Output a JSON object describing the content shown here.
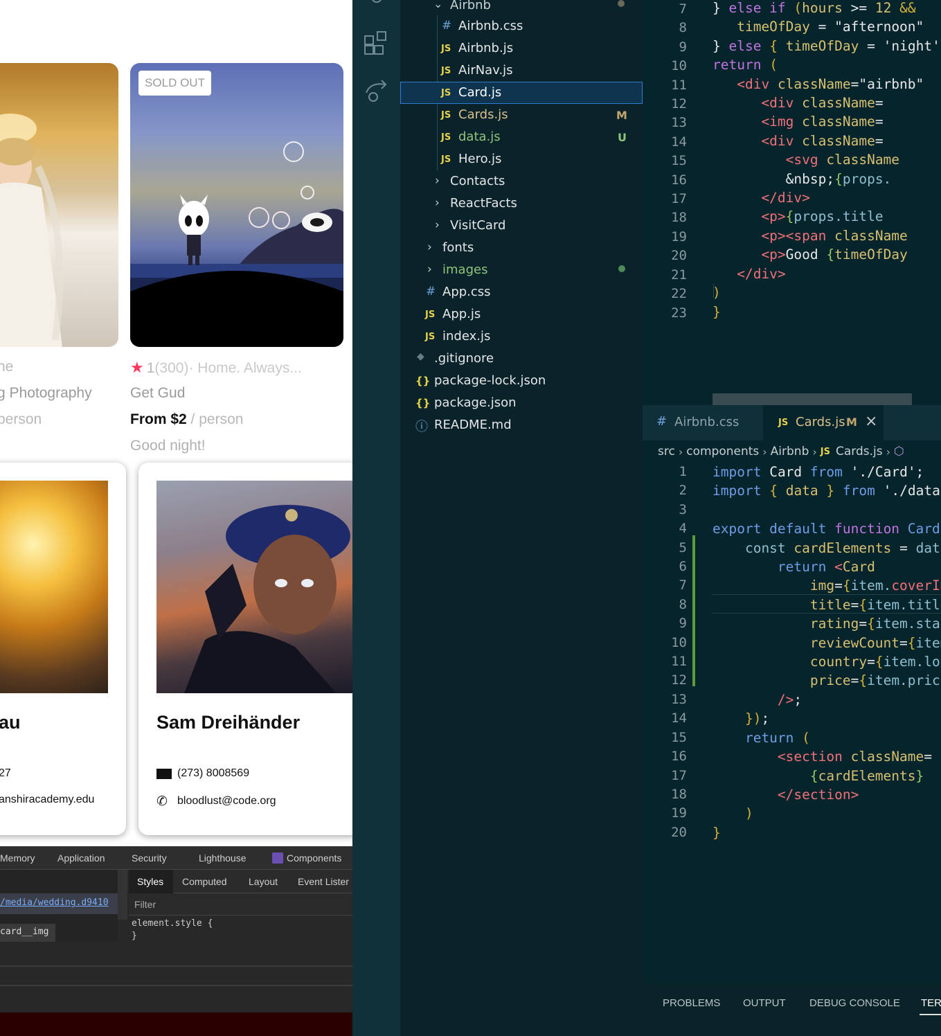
{
  "browser": {
    "card1": {
      "rating_text": "",
      "subtitle_partial": "ne",
      "title": "g Photography",
      "price_suffix": "person"
    },
    "card2": {
      "badge": "SOLD OUT",
      "rating": "1",
      "review_count": "(300)",
      "location": " · Home. Always...",
      "title": "Get Gud",
      "price_prefix": "From $2",
      "price_sep": " / ",
      "price_suffix": "person",
      "greeting": "Good night!"
    },
    "profile_left": {
      "name": "au",
      "phone": "27",
      "email": "anshiracademy.edu"
    },
    "profile_right": {
      "name": "Sam Dreihänder",
      "phone": "(273) 8008569",
      "email": "bloodlust@code.org"
    },
    "devtools": {
      "tabs": [
        "Memory",
        "Application",
        "Security",
        "Lighthouse",
        "Components"
      ],
      "subtabs": [
        "Styles",
        "Computed",
        "Layout",
        "Event Lister"
      ],
      "link": "/media/wedding.d9410",
      "selector": "card__img",
      "filter_placeholder": "Filter",
      "rule_open": "element.style {",
      "rule_close": "}"
    }
  },
  "explorer": {
    "items": [
      {
        "label": "Airbnb",
        "kind": "folder-open",
        "badge": "●"
      },
      {
        "label": "Airbnb.css",
        "kind": "css"
      },
      {
        "label": "Airbnb.js",
        "kind": "js"
      },
      {
        "label": "AirNav.js",
        "kind": "js"
      },
      {
        "label": "Card.js",
        "kind": "js",
        "selected": true
      },
      {
        "label": "Cards.js",
        "kind": "js",
        "badge": "M"
      },
      {
        "label": "data.js",
        "kind": "js",
        "badge": "U"
      },
      {
        "label": "Hero.js",
        "kind": "js"
      },
      {
        "label": "Contacts",
        "kind": "folder"
      },
      {
        "label": "ReactFacts",
        "kind": "folder"
      },
      {
        "label": "VisitCard",
        "kind": "folder"
      },
      {
        "label": "fonts",
        "kind": "folder"
      },
      {
        "label": "images",
        "kind": "folder",
        "badge": "●"
      },
      {
        "label": "App.css",
        "kind": "css"
      },
      {
        "label": "App.js",
        "kind": "js"
      },
      {
        "label": "index.js",
        "kind": "js"
      },
      {
        "label": ".gitignore",
        "kind": "git"
      },
      {
        "label": "package-lock.json",
        "kind": "json"
      },
      {
        "label": "package.json",
        "kind": "json"
      },
      {
        "label": "README.md",
        "kind": "info"
      }
    ],
    "js_icon": "JS",
    "css_icon": "#",
    "json_icon": "{}",
    "info_icon": "ⓘ",
    "git_icon": "◆"
  },
  "editor_top": {
    "line_numbers": [
      "7",
      "8",
      "9",
      "10",
      "11",
      "12",
      "13",
      "14",
      "15",
      "16",
      "17",
      "18",
      "19",
      "20",
      "21",
      "22",
      "23"
    ]
  },
  "tabs": [
    {
      "label": "Airbnb.css",
      "icon": "#"
    },
    {
      "label": "Cards.js",
      "icon": "JS",
      "modified": "M",
      "close": "×"
    }
  ],
  "breadcrumb": [
    "src",
    "components",
    "Airbnb",
    "Cards.js"
  ],
  "editor_bot": {
    "line_numbers": [
      "1",
      "2",
      "3",
      "4",
      "5",
      "6",
      "7",
      "8",
      "9",
      "10",
      "11",
      "12",
      "13",
      "14",
      "15",
      "16",
      "17",
      "18",
      "19",
      "20"
    ]
  },
  "panel": {
    "tabs": [
      "PROBLEMS",
      "OUTPUT",
      "DEBUG CONSOLE",
      "TER"
    ]
  }
}
